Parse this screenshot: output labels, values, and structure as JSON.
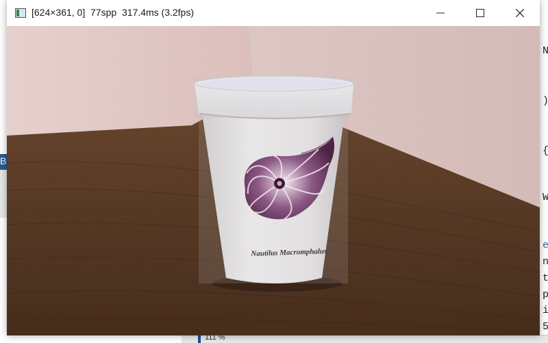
{
  "window": {
    "title": "[624×361, 0]  77spp  317.4ms (3.2fps)",
    "icon": "render-window-icon",
    "controls": {
      "minimize": "minimize-icon",
      "maximize": "maximize-icon",
      "close": "close-icon"
    }
  },
  "render": {
    "cup_label": "Nautilus Macromphalus",
    "colors": {
      "wall": "#e8cfcb",
      "table": "#5a3c27",
      "cup": "#ece9ea",
      "shell": "#6b3a63"
    }
  },
  "background": {
    "editor_chars": [
      "N",
      ")",
      "{",
      "W",
      "e",
      "n",
      "t",
      "p",
      "i",
      "5"
    ],
    "left_tab": "B",
    "zoom": "111 %"
  }
}
